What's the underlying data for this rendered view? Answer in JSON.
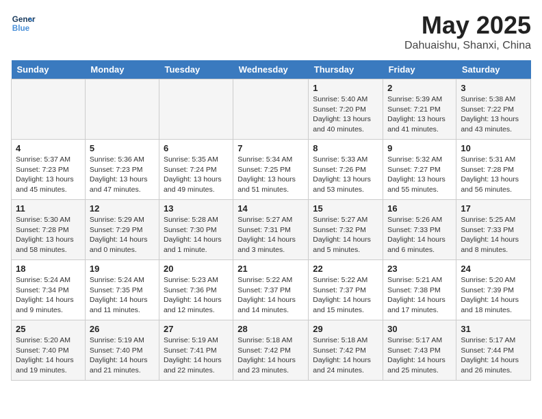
{
  "logo": {
    "line1": "General",
    "line2": "Blue"
  },
  "title": "May 2025",
  "subtitle": "Dahuaishu, Shanxi, China",
  "header": {
    "days": [
      "Sunday",
      "Monday",
      "Tuesday",
      "Wednesday",
      "Thursday",
      "Friday",
      "Saturday"
    ]
  },
  "weeks": [
    {
      "cells": [
        {
          "empty": true
        },
        {
          "empty": true
        },
        {
          "empty": true
        },
        {
          "empty": true
        },
        {
          "day": "1",
          "sunrise": "5:40 AM",
          "sunset": "7:20 PM",
          "daylight": "13 hours and 40 minutes."
        },
        {
          "day": "2",
          "sunrise": "5:39 AM",
          "sunset": "7:21 PM",
          "daylight": "13 hours and 41 minutes."
        },
        {
          "day": "3",
          "sunrise": "5:38 AM",
          "sunset": "7:22 PM",
          "daylight": "13 hours and 43 minutes."
        }
      ]
    },
    {
      "cells": [
        {
          "day": "4",
          "sunrise": "5:37 AM",
          "sunset": "7:23 PM",
          "daylight": "13 hours and 45 minutes."
        },
        {
          "day": "5",
          "sunrise": "5:36 AM",
          "sunset": "7:23 PM",
          "daylight": "13 hours and 47 minutes."
        },
        {
          "day": "6",
          "sunrise": "5:35 AM",
          "sunset": "7:24 PM",
          "daylight": "13 hours and 49 minutes."
        },
        {
          "day": "7",
          "sunrise": "5:34 AM",
          "sunset": "7:25 PM",
          "daylight": "13 hours and 51 minutes."
        },
        {
          "day": "8",
          "sunrise": "5:33 AM",
          "sunset": "7:26 PM",
          "daylight": "13 hours and 53 minutes."
        },
        {
          "day": "9",
          "sunrise": "5:32 AM",
          "sunset": "7:27 PM",
          "daylight": "13 hours and 55 minutes."
        },
        {
          "day": "10",
          "sunrise": "5:31 AM",
          "sunset": "7:28 PM",
          "daylight": "13 hours and 56 minutes."
        }
      ]
    },
    {
      "cells": [
        {
          "day": "11",
          "sunrise": "5:30 AM",
          "sunset": "7:28 PM",
          "daylight": "13 hours and 58 minutes."
        },
        {
          "day": "12",
          "sunrise": "5:29 AM",
          "sunset": "7:29 PM",
          "daylight": "14 hours and 0 minutes."
        },
        {
          "day": "13",
          "sunrise": "5:28 AM",
          "sunset": "7:30 PM",
          "daylight": "14 hours and 1 minute."
        },
        {
          "day": "14",
          "sunrise": "5:27 AM",
          "sunset": "7:31 PM",
          "daylight": "14 hours and 3 minutes."
        },
        {
          "day": "15",
          "sunrise": "5:27 AM",
          "sunset": "7:32 PM",
          "daylight": "14 hours and 5 minutes."
        },
        {
          "day": "16",
          "sunrise": "5:26 AM",
          "sunset": "7:33 PM",
          "daylight": "14 hours and 6 minutes."
        },
        {
          "day": "17",
          "sunrise": "5:25 AM",
          "sunset": "7:33 PM",
          "daylight": "14 hours and 8 minutes."
        }
      ]
    },
    {
      "cells": [
        {
          "day": "18",
          "sunrise": "5:24 AM",
          "sunset": "7:34 PM",
          "daylight": "14 hours and 9 minutes."
        },
        {
          "day": "19",
          "sunrise": "5:24 AM",
          "sunset": "7:35 PM",
          "daylight": "14 hours and 11 minutes."
        },
        {
          "day": "20",
          "sunrise": "5:23 AM",
          "sunset": "7:36 PM",
          "daylight": "14 hours and 12 minutes."
        },
        {
          "day": "21",
          "sunrise": "5:22 AM",
          "sunset": "7:37 PM",
          "daylight": "14 hours and 14 minutes."
        },
        {
          "day": "22",
          "sunrise": "5:22 AM",
          "sunset": "7:37 PM",
          "daylight": "14 hours and 15 minutes."
        },
        {
          "day": "23",
          "sunrise": "5:21 AM",
          "sunset": "7:38 PM",
          "daylight": "14 hours and 17 minutes."
        },
        {
          "day": "24",
          "sunrise": "5:20 AM",
          "sunset": "7:39 PM",
          "daylight": "14 hours and 18 minutes."
        }
      ]
    },
    {
      "cells": [
        {
          "day": "25",
          "sunrise": "5:20 AM",
          "sunset": "7:40 PM",
          "daylight": "14 hours and 19 minutes."
        },
        {
          "day": "26",
          "sunrise": "5:19 AM",
          "sunset": "7:40 PM",
          "daylight": "14 hours and 21 minutes."
        },
        {
          "day": "27",
          "sunrise": "5:19 AM",
          "sunset": "7:41 PM",
          "daylight": "14 hours and 22 minutes."
        },
        {
          "day": "28",
          "sunrise": "5:18 AM",
          "sunset": "7:42 PM",
          "daylight": "14 hours and 23 minutes."
        },
        {
          "day": "29",
          "sunrise": "5:18 AM",
          "sunset": "7:42 PM",
          "daylight": "14 hours and 24 minutes."
        },
        {
          "day": "30",
          "sunrise": "5:17 AM",
          "sunset": "7:43 PM",
          "daylight": "14 hours and 25 minutes."
        },
        {
          "day": "31",
          "sunrise": "5:17 AM",
          "sunset": "7:44 PM",
          "daylight": "14 hours and 26 minutes."
        }
      ]
    }
  ]
}
